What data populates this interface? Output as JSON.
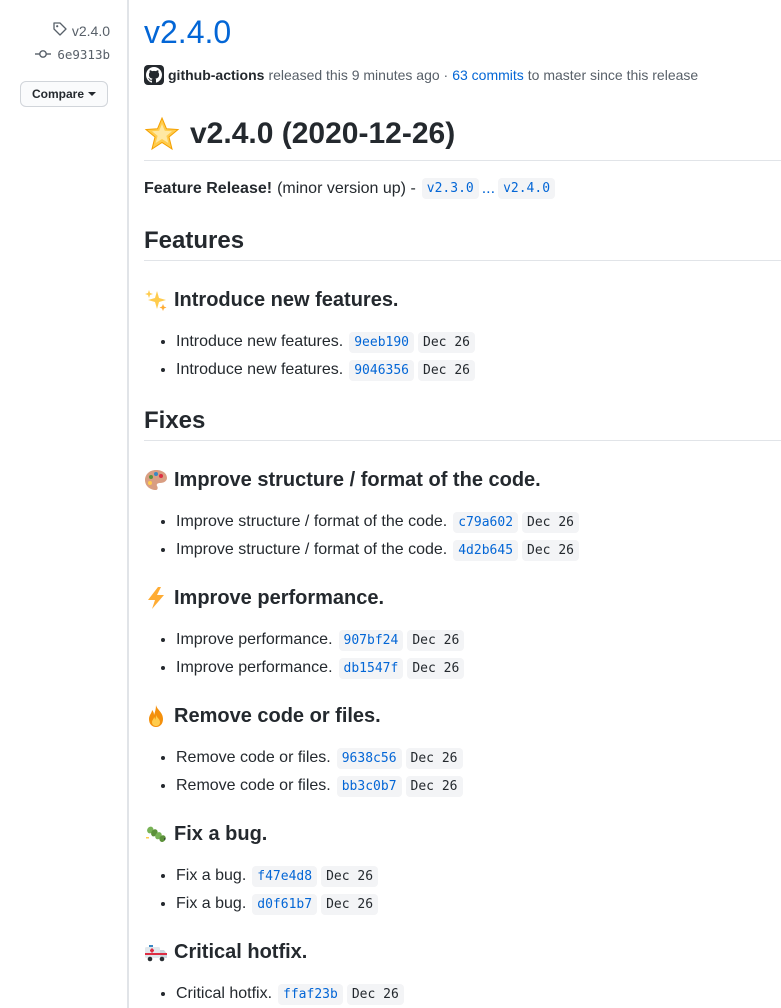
{
  "sidebar": {
    "tag": "v2.4.0",
    "commit": "6e9313b",
    "compare_label": "Compare"
  },
  "release": {
    "title": "v2.4.0",
    "author": "github-actions",
    "released_text": "released this 9 minutes ago ·",
    "commits_link": "63 commits",
    "since_text": "to master since this release",
    "heading": "v2.4.0 (2020-12-26)",
    "summary_bold": "Feature Release!",
    "summary_text": "(minor version up) -",
    "compare_from": "v2.3.0",
    "compare_sep": "...",
    "compare_to": "v2.4.0"
  },
  "sections": {
    "features": {
      "title": "Features",
      "groups": [
        {
          "icon": "sparkles-icon",
          "title": "Introduce new features.",
          "items": [
            {
              "text": "Introduce new features.",
              "hash": "9eeb190",
              "date": "Dec 26"
            },
            {
              "text": "Introduce new features.",
              "hash": "9046356",
              "date": "Dec 26"
            }
          ]
        }
      ]
    },
    "fixes": {
      "title": "Fixes",
      "groups": [
        {
          "icon": "palette-icon",
          "title": "Improve structure / format of the code.",
          "items": [
            {
              "text": "Improve structure / format of the code.",
              "hash": "c79a602",
              "date": "Dec 26"
            },
            {
              "text": "Improve structure / format of the code.",
              "hash": "4d2b645",
              "date": "Dec 26"
            }
          ]
        },
        {
          "icon": "zap-icon",
          "title": "Improve performance.",
          "items": [
            {
              "text": "Improve performance.",
              "hash": "907bf24",
              "date": "Dec 26"
            },
            {
              "text": "Improve performance.",
              "hash": "db1547f",
              "date": "Dec 26"
            }
          ]
        },
        {
          "icon": "fire-icon",
          "title": "Remove code or files.",
          "items": [
            {
              "text": "Remove code or files.",
              "hash": "9638c56",
              "date": "Dec 26"
            },
            {
              "text": "Remove code or files.",
              "hash": "bb3c0b7",
              "date": "Dec 26"
            }
          ]
        },
        {
          "icon": "bug-icon",
          "title": "Fix a bug.",
          "items": [
            {
              "text": "Fix a bug.",
              "hash": "f47e4d8",
              "date": "Dec 26"
            },
            {
              "text": "Fix a bug.",
              "hash": "d0f61b7",
              "date": "Dec 26"
            }
          ]
        },
        {
          "icon": "ambulance-icon",
          "title": "Critical hotfix.",
          "items": [
            {
              "text": "Critical hotfix.",
              "hash": "ffaf23b",
              "date": "Dec 26"
            }
          ]
        }
      ]
    }
  },
  "colors": {
    "link": "#0366d6",
    "text": "#24292e",
    "muted": "#586069",
    "border": "#e1e4e8",
    "code_bg": "#f3f4f6"
  }
}
